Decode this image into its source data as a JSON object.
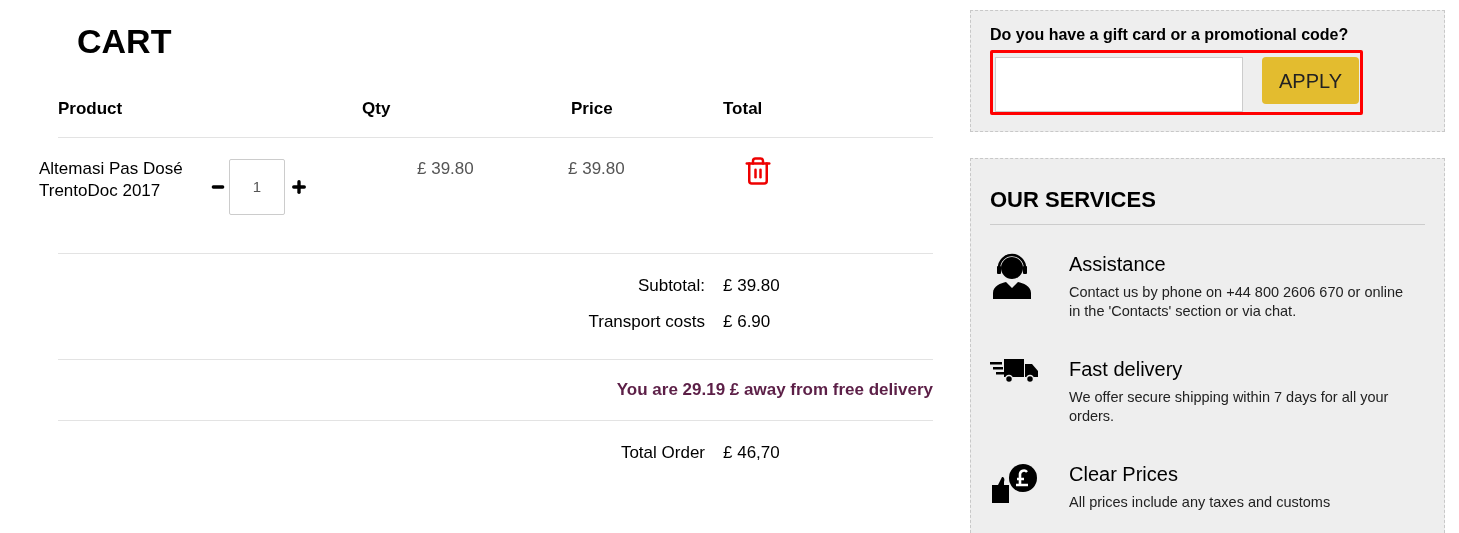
{
  "cart": {
    "title": "CART",
    "columns": [
      "Product",
      "Qty",
      "Price",
      "Total"
    ],
    "items": [
      {
        "name": "Altemasi Pas Dosé TrentoDoc 2017",
        "quantity": "1",
        "price": "£ 39.80",
        "total": "£ 39.80"
      }
    ]
  },
  "summary": [
    {
      "label": "Subtotal:",
      "value": "£ 39.80"
    },
    {
      "label": "Transport costs",
      "value": "£ 6.90"
    }
  ],
  "free_delivery_notice": "You are 29.19 £ away from free delivery",
  "total": {
    "label": "Total Order",
    "value": "£ 46,70"
  },
  "promo": {
    "question": "Do you have a gift card or a promotional code?",
    "button": "APPLY",
    "highlighted": true
  },
  "services": {
    "title": "OUR SERVICES",
    "items": [
      {
        "kind": "assistance",
        "title": "Assistance",
        "text": "Contact us by phone on +44 800 2606 670 or online in the 'Contacts' section or via chat."
      },
      {
        "kind": "delivery",
        "title": "Fast delivery",
        "text": "We offer secure shipping within 7 days for all your orders."
      },
      {
        "kind": "prices",
        "title": "Clear Prices",
        "text": "All prices include any taxes and customs"
      }
    ]
  }
}
